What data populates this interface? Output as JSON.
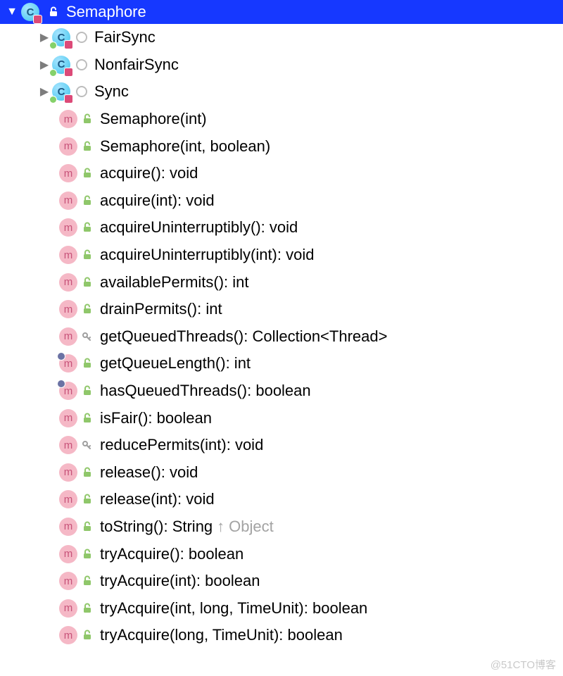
{
  "header": {
    "label": "Semaphore"
  },
  "innerClasses": [
    {
      "label": "FairSync"
    },
    {
      "label": "NonfairSync"
    },
    {
      "label": "Sync"
    }
  ],
  "members": [
    {
      "label": "Semaphore(int)",
      "access": "public",
      "override": false
    },
    {
      "label": "Semaphore(int, boolean)",
      "access": "public",
      "override": false
    },
    {
      "label": "acquire(): void",
      "access": "public",
      "override": false
    },
    {
      "label": "acquire(int): void",
      "access": "public",
      "override": false
    },
    {
      "label": "acquireUninterruptibly(): void",
      "access": "public",
      "override": false
    },
    {
      "label": "acquireUninterruptibly(int): void",
      "access": "public",
      "override": false
    },
    {
      "label": "availablePermits(): int",
      "access": "public",
      "override": false
    },
    {
      "label": "drainPermits(): int",
      "access": "public",
      "override": false
    },
    {
      "label": "getQueuedThreads(): Collection<Thread>",
      "access": "protected",
      "override": false
    },
    {
      "label": "getQueueLength(): int",
      "access": "public",
      "override": true
    },
    {
      "label": "hasQueuedThreads(): boolean",
      "access": "public",
      "override": true
    },
    {
      "label": "isFair(): boolean",
      "access": "public",
      "override": false
    },
    {
      "label": "reducePermits(int): void",
      "access": "protected",
      "override": false
    },
    {
      "label": "release(): void",
      "access": "public",
      "override": false
    },
    {
      "label": "release(int): void",
      "access": "public",
      "override": false
    },
    {
      "label": "toString(): String",
      "access": "public",
      "override": false,
      "inherit": "Object"
    },
    {
      "label": "tryAcquire(): boolean",
      "access": "public",
      "override": false
    },
    {
      "label": "tryAcquire(int): boolean",
      "access": "public",
      "override": false
    },
    {
      "label": "tryAcquire(int, long, TimeUnit): boolean",
      "access": "public",
      "override": false
    },
    {
      "label": "tryAcquire(long, TimeUnit): boolean",
      "access": "public",
      "override": false
    }
  ],
  "watermark": "@51CTO博客"
}
